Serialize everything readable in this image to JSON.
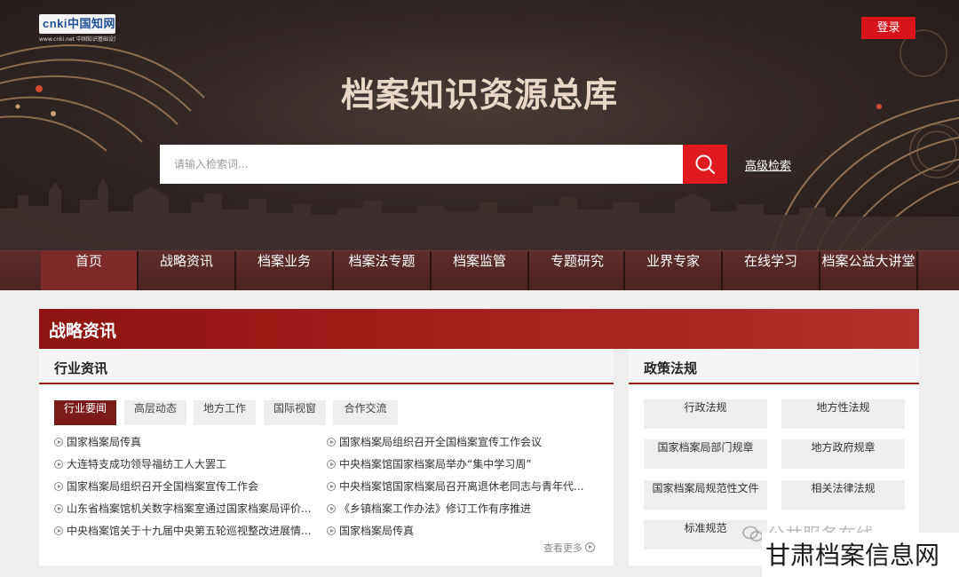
{
  "header": {
    "logo_text": "cnki中国知网",
    "logo_subtext": "www.cnki.net 中国知识基础设施工程",
    "login_label": "登录",
    "site_title": "档案知识资源总库"
  },
  "search": {
    "placeholder": "请输入检索词...",
    "advanced_label": "高级检索"
  },
  "nav": {
    "items": [
      {
        "label": "首页",
        "active": true
      },
      {
        "label": "战略资讯"
      },
      {
        "label": "档案业务"
      },
      {
        "label": "档案法专题"
      },
      {
        "label": "档案监管"
      },
      {
        "label": "专题研究"
      },
      {
        "label": "业界专家"
      },
      {
        "label": "在线学习"
      },
      {
        "label": "档案公益大讲堂"
      }
    ]
  },
  "section": {
    "title": "战略资讯"
  },
  "industry": {
    "title": "行业资讯",
    "tabs": [
      "行业要闻",
      "高层动态",
      "地方工作",
      "国际视窗",
      "合作交流"
    ],
    "active_tab": 0,
    "news_left": [
      "国家档案局传真",
      "大连特支成功领导福纺工人大罢工",
      "国家档案局组织召开全国档案宣传工作会",
      "山东省档案馆机关数字档案室通过国家档案局评价...",
      "中央档案馆关于十九届中央第五轮巡视整改进展情..."
    ],
    "news_right": [
      "国家档案局组织召开全国档案宣传工作会议",
      "中央档案馆国家档案局举办“集中学习周”",
      "中央档案馆国家档案局召开离退休老同志与青年代...",
      "《乡镇档案工作办法》修订工作有序推进",
      "国家档案局传真"
    ],
    "more_label": "查看更多"
  },
  "policy": {
    "title": "政策法规",
    "items": [
      "行政法规",
      "地方性法规",
      "国家档案局部门规章",
      "地方政府规章",
      "国家档案局规范性文件",
      "相关法律法规",
      "标准规范"
    ]
  },
  "watermark": {
    "wechat": "公共服务在线",
    "site": "甘肃档案信息网"
  },
  "colors": {
    "accent_red": "#d7141a",
    "nav_bg": "#5c2d2b",
    "banner_red": "#a11d1a",
    "tab_active": "#7a1b19"
  }
}
